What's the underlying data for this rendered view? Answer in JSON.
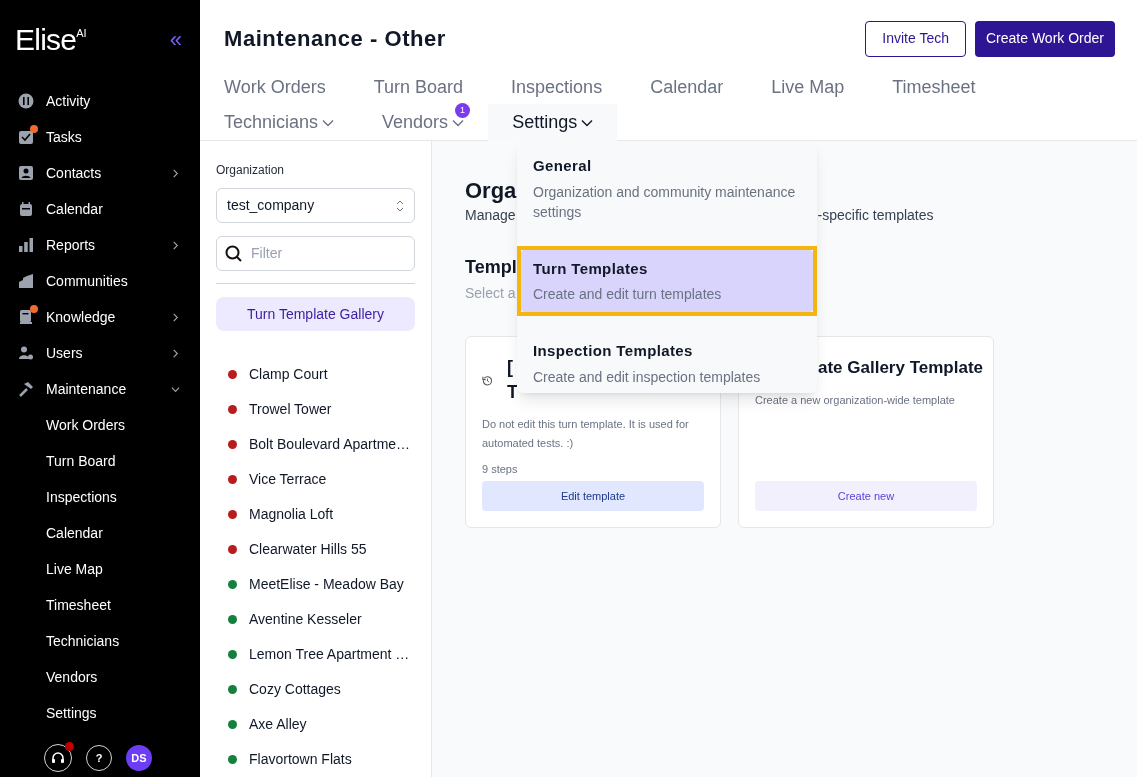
{
  "logo": {
    "name": "Elise",
    "suffix": "AI"
  },
  "collapse": "«",
  "sidebar": {
    "items": [
      {
        "label": "Activity",
        "badge": false
      },
      {
        "label": "Tasks",
        "badge": true
      },
      {
        "label": "Contacts",
        "badge": false,
        "expanded": false
      },
      {
        "label": "Calendar",
        "badge": false
      },
      {
        "label": "Reports",
        "badge": false,
        "expanded": false
      },
      {
        "label": "Communities",
        "badge": false
      },
      {
        "label": "Knowledge",
        "badge": true,
        "expanded": false
      },
      {
        "label": "Users",
        "badge": false,
        "expanded": false
      },
      {
        "label": "Maintenance",
        "badge": false,
        "expanded": true,
        "children": [
          {
            "label": "Work Orders"
          },
          {
            "label": "Turn Board"
          },
          {
            "label": "Inspections"
          },
          {
            "label": "Calendar"
          },
          {
            "label": "Live Map"
          },
          {
            "label": "Timesheet"
          },
          {
            "label": "Technicians"
          },
          {
            "label": "Vendors"
          },
          {
            "label": "Settings"
          }
        ]
      }
    ]
  },
  "footer": {
    "support_badge": true,
    "help": "?",
    "avatar": "DS"
  },
  "header": {
    "title": "Maintenance - Other",
    "buttons": [
      {
        "label": "Invite Tech",
        "kind": "outline"
      },
      {
        "label": "Create Work Order",
        "kind": "primary"
      }
    ]
  },
  "tabs": [
    [
      {
        "label": "Work Orders",
        "selected": false,
        "dropdown": false
      },
      {
        "label": "Turn Board",
        "selected": false,
        "dropdown": false
      },
      {
        "label": "Inspections",
        "selected": false,
        "dropdown": false
      },
      {
        "label": "Calendar",
        "selected": false,
        "dropdown": false
      },
      {
        "label": "Live Map",
        "selected": false,
        "dropdown": false
      },
      {
        "label": "Timesheet",
        "selected": false,
        "dropdown": false
      }
    ],
    [
      {
        "label": "Technicians",
        "selected": false,
        "dropdown": true
      },
      {
        "label": "Vendors",
        "selected": false,
        "dropdown": true,
        "badge": "1"
      },
      {
        "label": "Settings",
        "selected": true,
        "dropdown": true
      }
    ]
  ],
  "settings_menu": [
    {
      "title": "General",
      "description": "Organization and community maintenance settings",
      "selected": false
    },
    {
      "title": "Turn Templates",
      "description": "Create and edit turn templates",
      "selected": true
    },
    {
      "title": "Inspection Templates",
      "description": "Create and edit inspection templates",
      "selected": false
    }
  ],
  "left_panel": {
    "organization_label": "Organization",
    "organization": "test_company",
    "filter": {
      "placeholder": "Filter"
    },
    "gallery_button": "Turn Template Gallery",
    "communities": [
      {
        "name": "Clamp Court",
        "color": "#b91c1c"
      },
      {
        "name": "Trowel Tower",
        "color": "#b91c1c"
      },
      {
        "name": "Bolt Boulevard Apartme…",
        "color": "#b91c1c"
      },
      {
        "name": "Vice Terrace",
        "color": "#b91c1c"
      },
      {
        "name": "Magnolia Loft",
        "color": "#b91c1c"
      },
      {
        "name": "Clearwater Hills 55",
        "color": "#b91c1c"
      },
      {
        "name": "MeetElise - Meadow Bay",
        "color": "#15803d"
      },
      {
        "name": "Aventine Kesseler",
        "color": "#15803d"
      },
      {
        "name": "Lemon Tree Apartment …",
        "color": "#15803d"
      },
      {
        "name": "Cozy Cottages",
        "color": "#15803d"
      },
      {
        "name": "Axe Alley",
        "color": "#15803d"
      },
      {
        "name": "Flavortown Flats",
        "color": "#15803d"
      }
    ]
  },
  "content": {
    "heading": "Orga",
    "subtitle_start": "Manage",
    "subtitle_end": "-specific templates",
    "section_title": "Templ",
    "section_subtitle": "Select a",
    "cards": [
      {
        "kind": "template",
        "title_line_1": "[",
        "title_line_2": "T",
        "description": "Do not edit this turn template. It is used for automated tests. :)",
        "steps": "9 steps",
        "button": "Edit template"
      },
      {
        "kind": "new",
        "title": "ate Gallery Template",
        "description": "Create a new organization-wide template",
        "button": "Create new"
      }
    ]
  }
}
